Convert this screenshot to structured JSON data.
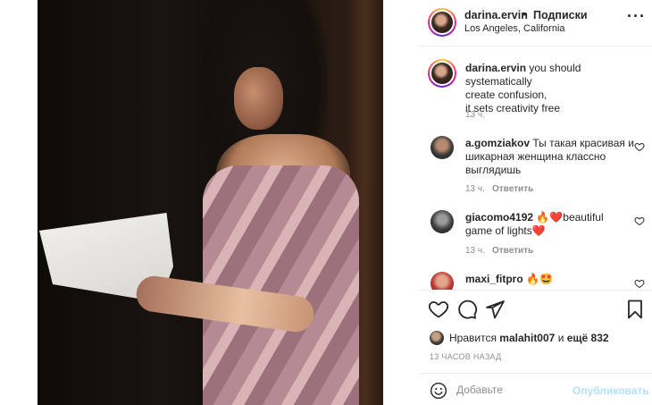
{
  "post": {
    "username": "darina.ervin",
    "dot": "•",
    "follow_label": "Подписки",
    "location": "Los Angeles, California",
    "more_label": "···"
  },
  "caption": {
    "username": "darina.ervin",
    "text_line1": "you should systematically",
    "text_line2": "create confusion,",
    "text_line3": "it sets creativity free",
    "time": "13 ч."
  },
  "comments": [
    {
      "username": "a.gomziakov",
      "text_line1": "Ты такая красивая и",
      "text_line2": "шикарная женщина классно",
      "text_line3": "выглядишь",
      "time": "13 ч.",
      "reply_label": "Ответить"
    },
    {
      "username": "giacomo4192",
      "text_line1": "🔥❤️beautiful",
      "text_line2": "game of lights❤️",
      "time": "13 ч.",
      "reply_label": "Ответить"
    },
    {
      "username": "maxi_fitpro",
      "text_line1": "🔥🤩"
    }
  ],
  "likes": {
    "prefix": "Нравится",
    "user": "malahit007",
    "middle": "и",
    "others": "ещё 832"
  },
  "timestamp": "13 ЧАСОВ НАЗАД",
  "add_comment": {
    "placeholder": "Добавьте",
    "publish_label": "Опубликовать"
  },
  "colors": {
    "publish_disabled": "#b2dffc",
    "text": "#262626",
    "muted": "#8e8e8e"
  }
}
